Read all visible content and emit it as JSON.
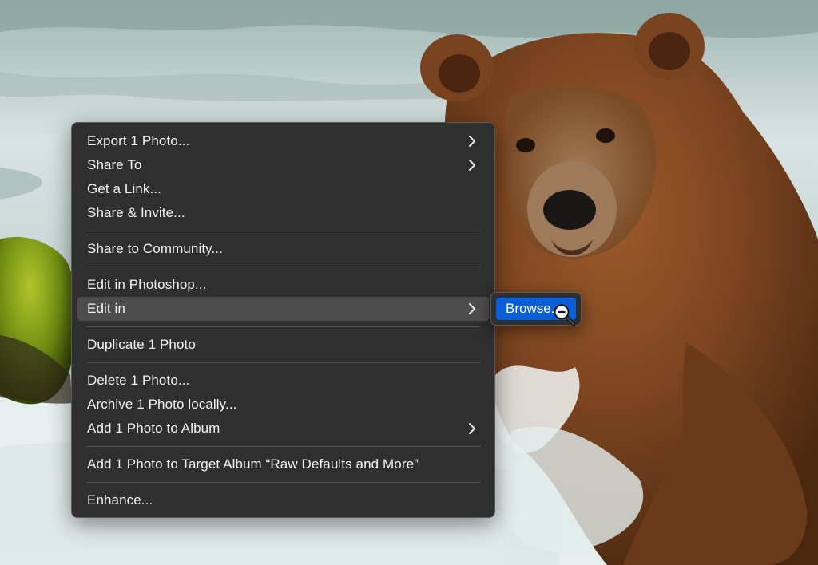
{
  "background": {
    "description_icon": "bear-photo"
  },
  "menu": {
    "groups": [
      [
        {
          "label": "Export 1 Photo...",
          "submenu": true
        },
        {
          "label": "Share To",
          "submenu": true
        },
        {
          "label": "Get a Link...",
          "submenu": false
        },
        {
          "label": "Share & Invite...",
          "submenu": false
        }
      ],
      [
        {
          "label": "Share to Community...",
          "submenu": false
        }
      ],
      [
        {
          "label": "Edit in Photoshop...",
          "submenu": false
        },
        {
          "label": "Edit in",
          "submenu": true,
          "highlighted": true
        }
      ],
      [
        {
          "label": "Duplicate 1 Photo",
          "submenu": false
        }
      ],
      [
        {
          "label": "Delete 1 Photo...",
          "submenu": false
        },
        {
          "label": "Archive 1 Photo locally...",
          "submenu": false
        },
        {
          "label": "Add 1 Photo to Album",
          "submenu": true
        }
      ],
      [
        {
          "label": "Add 1 Photo to Target Album “Raw Defaults and More”",
          "submenu": false
        }
      ],
      [
        {
          "label": "Enhance...",
          "submenu": false
        }
      ]
    ]
  },
  "submenu": {
    "items": [
      {
        "label": "Browse..."
      }
    ]
  },
  "colors": {
    "menu_bg": "#2f2f2f",
    "highlight": "#4d4d4d",
    "accent": "#0a5fd9"
  },
  "cursor": {
    "icon": "zoom-out-cursor-icon"
  }
}
